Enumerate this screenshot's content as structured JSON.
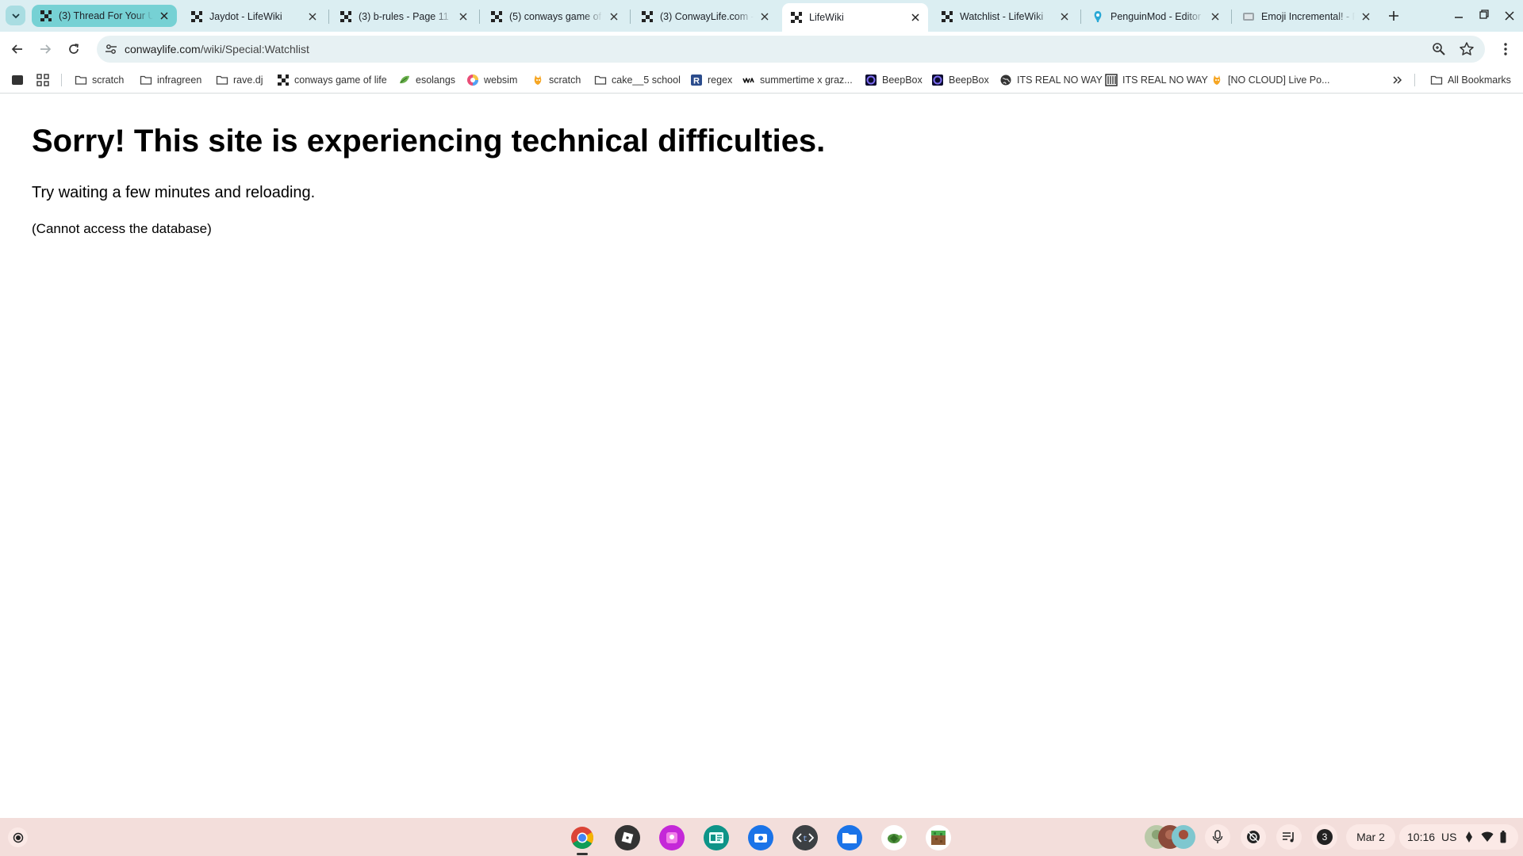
{
  "tabs": [
    {
      "title": "(3) Thread For Your Un",
      "favicon": "conwaylife-icon",
      "state": "highlight"
    },
    {
      "title": "Jaydot - LifeWiki",
      "favicon": "lifewiki-icon",
      "state": "normal"
    },
    {
      "title": "(3) b-rules - Page 11 -",
      "favicon": "conwaylife-icon",
      "state": "normal"
    },
    {
      "title": "(5) conways game of",
      "favicon": "conwaylife-icon",
      "state": "normal"
    },
    {
      "title": "(3) ConwayLife.com -",
      "favicon": "conwaylife-icon",
      "state": "normal"
    },
    {
      "title": "LifeWiki",
      "favicon": "lifewiki-icon",
      "state": "active"
    },
    {
      "title": "Watchlist - LifeWiki",
      "favicon": "lifewiki-icon",
      "state": "normal"
    },
    {
      "title": "PenguinMod - Editor",
      "favicon": "penguinmod-icon",
      "state": "normal"
    },
    {
      "title": "Emoji Incremental! - R",
      "favicon": "emoji-icon",
      "state": "normal"
    }
  ],
  "address": {
    "host": "conwaylife.com",
    "path": "/wiki/Special:Watchlist"
  },
  "bookmarks": {
    "items": [
      {
        "label": "scratch",
        "icon": "folder-icon"
      },
      {
        "label": "infragreen",
        "icon": "folder-icon"
      },
      {
        "label": "rave.dj",
        "icon": "folder-icon"
      },
      {
        "label": "conways game of life",
        "icon": "conwaylife-icon"
      },
      {
        "label": "esolangs",
        "icon": "esolangs-icon"
      },
      {
        "label": "websim",
        "icon": "websim-icon"
      },
      {
        "label": "scratch",
        "icon": "scratch-cat-icon"
      },
      {
        "label": "cake__5 school",
        "icon": "folder-icon"
      },
      {
        "label": "regex",
        "icon": "regex-icon"
      },
      {
        "label": "summertime x graz...",
        "icon": "rave-icon"
      },
      {
        "label": "BeepBox",
        "icon": "beepbox-icon"
      },
      {
        "label": "BeepBox",
        "icon": "beepbox-icon"
      },
      {
        "label": "ITS REAL NO WAY",
        "icon": "globe-icon"
      },
      {
        "label": "ITS REAL NO WAY",
        "icon": "book-icon"
      },
      {
        "label": "[NO CLOUD] Live Po...",
        "icon": "scratch-cat-icon"
      }
    ],
    "all_bookmarks": "All Bookmarks"
  },
  "page": {
    "title": "Sorry! This site is experiencing technical difficulties.",
    "message": "Try waiting a few minutes and reloading.",
    "detail": "(Cannot access the database)"
  },
  "shelf": {
    "apps": [
      "chrome-icon",
      "roblox-icon",
      "gallery-icon",
      "docs-icon",
      "camera-icon",
      "code-icon",
      "files-icon",
      "turtle-icon",
      "minecraft-icon"
    ],
    "notification_count": "3",
    "date": "Mar 2",
    "time": "10:16",
    "locale": "US"
  },
  "colors": {
    "tab_strip": "#dbeef2",
    "highlight_tab": "#76d1d4",
    "omnibox": "#e7f1f3",
    "shelf": "#f3dedb"
  }
}
